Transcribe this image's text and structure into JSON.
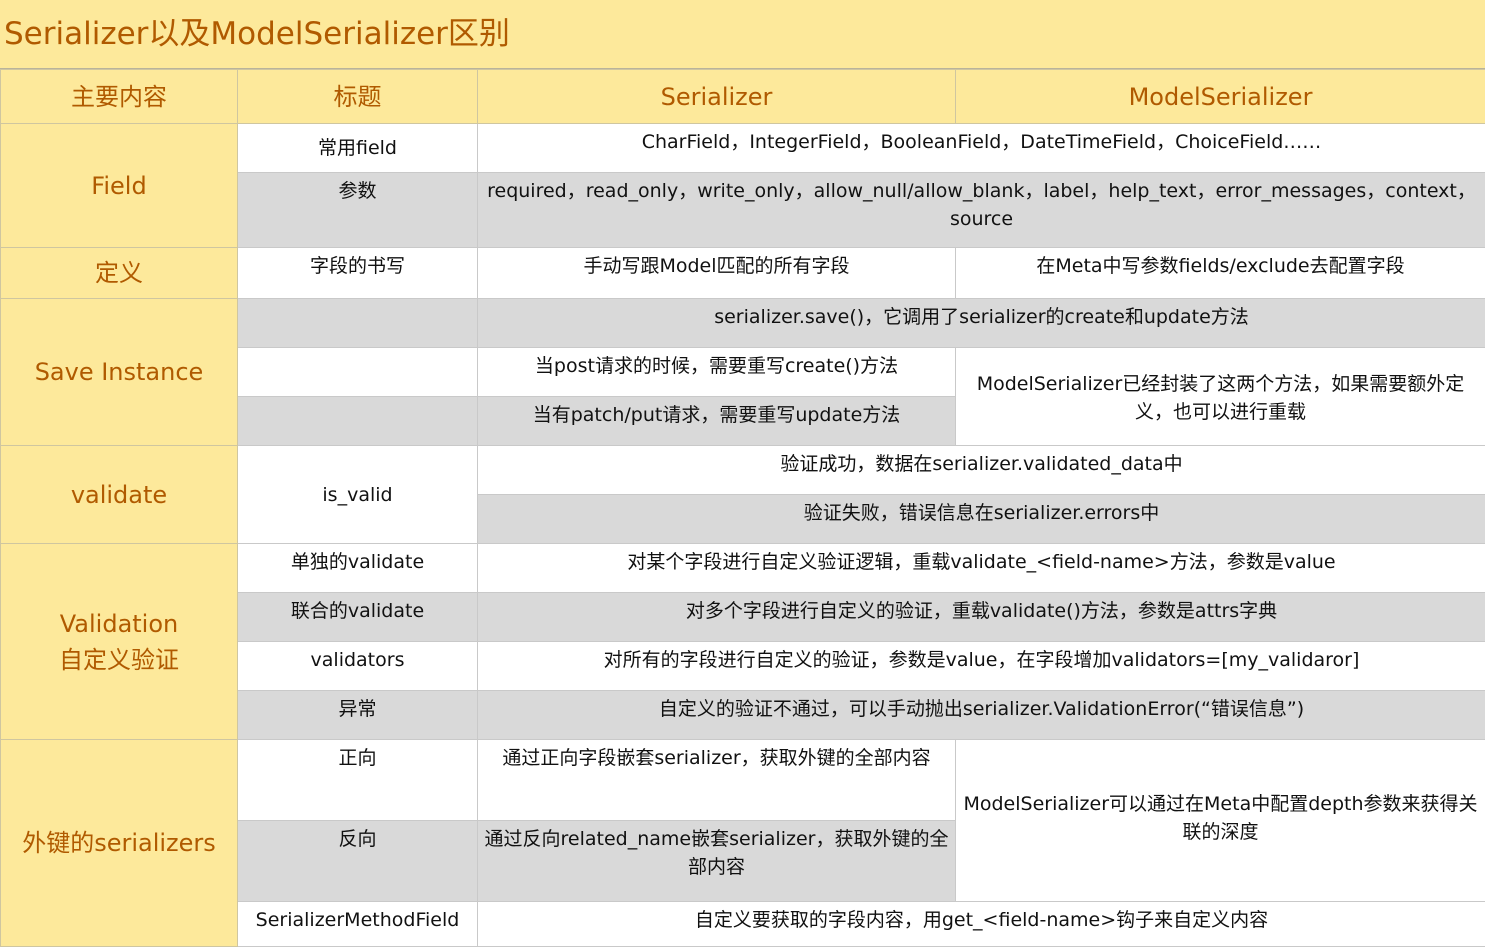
{
  "title": "Serializer以及ModelSerializer区别",
  "headers": {
    "main": "主要内容",
    "title": "标题",
    "serializer": "Serializer",
    "model_serializer": "ModelSerializer"
  },
  "field": {
    "group": "Field",
    "common_label": "常用field",
    "common_value": "CharField，IntegerField，BooleanField，DateTimeField，ChoiceField……",
    "params_label": "参数",
    "params_value": "required，read_only，write_only，allow_null/allow_blank，label，help_text，error_messages，context，source"
  },
  "definition": {
    "group": "定义",
    "label": "字段的书写",
    "serializer": "手动写跟Model匹配的所有字段",
    "model_serializer": "在Meta中写参数fields/exclude去配置字段"
  },
  "save_instance": {
    "group": "Save Instance",
    "save_all": "serializer.save()，它调用了serializer的create和update方法",
    "post": "当post请求的时候，需要重写create()方法",
    "patch": "当有patch/put请求，需要重写update方法",
    "model_serializer": "ModelSerializer已经封装了这两个方法，如果需要额外定义，也可以进行重载"
  },
  "validate": {
    "group": "validate",
    "label": "is_valid",
    "success": "验证成功，数据在serializer.validated_data中",
    "fail": "验证失败，错误信息在serializer.errors中"
  },
  "validation": {
    "group_line1": "Validation",
    "group_line2": "自定义验证",
    "single_label": "单独的validate",
    "single_value": "对某个字段进行自定义验证逻辑，重载validate_<field-name>方法，参数是value",
    "joint_label": "联合的validate",
    "joint_value": "对多个字段进行自定义的验证，重载validate()方法，参数是attrs字典",
    "validators_label": "validators",
    "validators_value": "对所有的字段进行自定义的验证，参数是value，在字段增加validators=[my_validaror]",
    "exception_label": "异常",
    "exception_value": "自定义的验证不通过，可以手动抛出serializer.ValidationError(“错误信息”)"
  },
  "foreign": {
    "group": "外键的serializers",
    "forward_label": "正向",
    "forward_value": "通过正向字段嵌套serializer，获取外键的全部内容",
    "reverse_label": "反向",
    "reverse_value": "通过反向related_name嵌套serializer，获取外键的全部内容",
    "model_serializer": "ModelSerializer可以通过在Meta中配置depth参数来获得关联的深度",
    "method_label": "SerializerMethodField",
    "method_value": "自定义要获取的字段内容，用get_<field-name>钩子来自定义内容"
  }
}
